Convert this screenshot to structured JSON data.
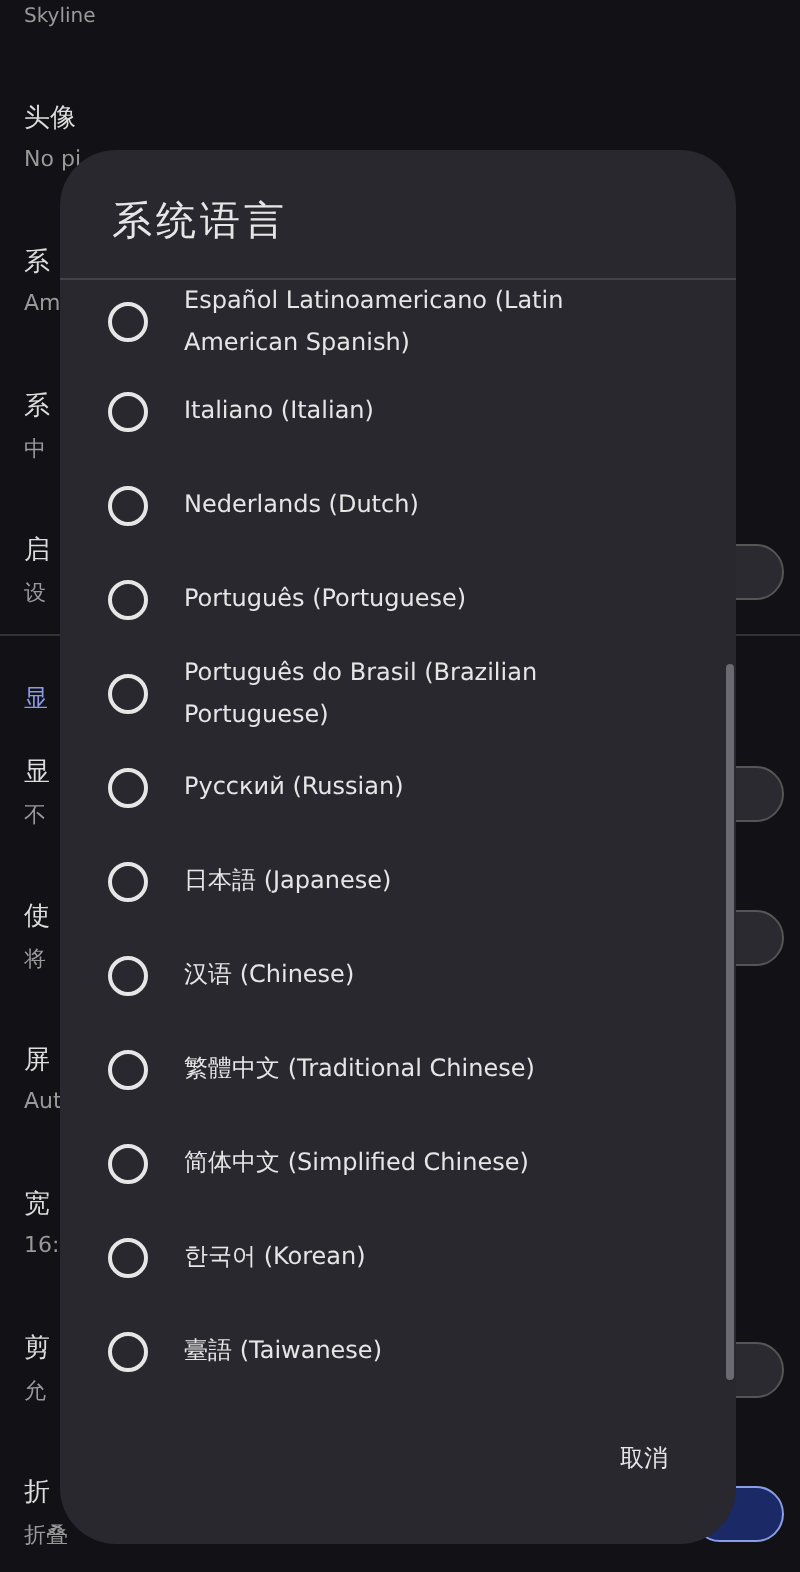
{
  "settings": {
    "header": "Skyline",
    "rows": [
      {
        "kind": "item",
        "title": "头像",
        "subtitle": "No pi"
      },
      {
        "kind": "item",
        "title": "系",
        "subtitle": "Am"
      },
      {
        "kind": "item",
        "title": "系",
        "subtitle": "中"
      },
      {
        "kind": "toggle",
        "title": "启",
        "subtitle": "设",
        "on": false
      },
      {
        "kind": "section",
        "title": "显"
      },
      {
        "kind": "toggle",
        "title": "显",
        "subtitle": "不",
        "on": false
      },
      {
        "kind": "toggle",
        "title": "使",
        "subtitle": "将",
        "on": false
      },
      {
        "kind": "item",
        "title": "屏",
        "subtitle": "Aut"
      },
      {
        "kind": "item",
        "title": "宽",
        "subtitle": "16:"
      },
      {
        "kind": "toggle",
        "title": "剪",
        "subtitle": "允",
        "on": false
      },
      {
        "kind": "toggle",
        "title": "折",
        "subtitle": "折叠",
        "on": true
      }
    ]
  },
  "dialog": {
    "title": "系统语言",
    "options": [
      {
        "label": "Español Latinoamericano (Latin American Spanish)",
        "selected": false
      },
      {
        "label": "Italiano (Italian)",
        "selected": false
      },
      {
        "label": "Nederlands (Dutch)",
        "selected": false
      },
      {
        "label": "Português (Portuguese)",
        "selected": false
      },
      {
        "label": "Português do Brasil (Brazilian Portuguese)",
        "selected": false
      },
      {
        "label": "Русский (Russian)",
        "selected": false
      },
      {
        "label": "日本語 (Japanese)",
        "selected": false
      },
      {
        "label": "汉语 (Chinese)",
        "selected": false
      },
      {
        "label": "繁體中文 (Traditional Chinese)",
        "selected": false
      },
      {
        "label": "简体中文 (Simplified Chinese)",
        "selected": false
      },
      {
        "label": "한국어 (Korean)",
        "selected": false
      },
      {
        "label": "臺語 (Taiwanese)",
        "selected": false
      }
    ],
    "cancel": "取消"
  }
}
